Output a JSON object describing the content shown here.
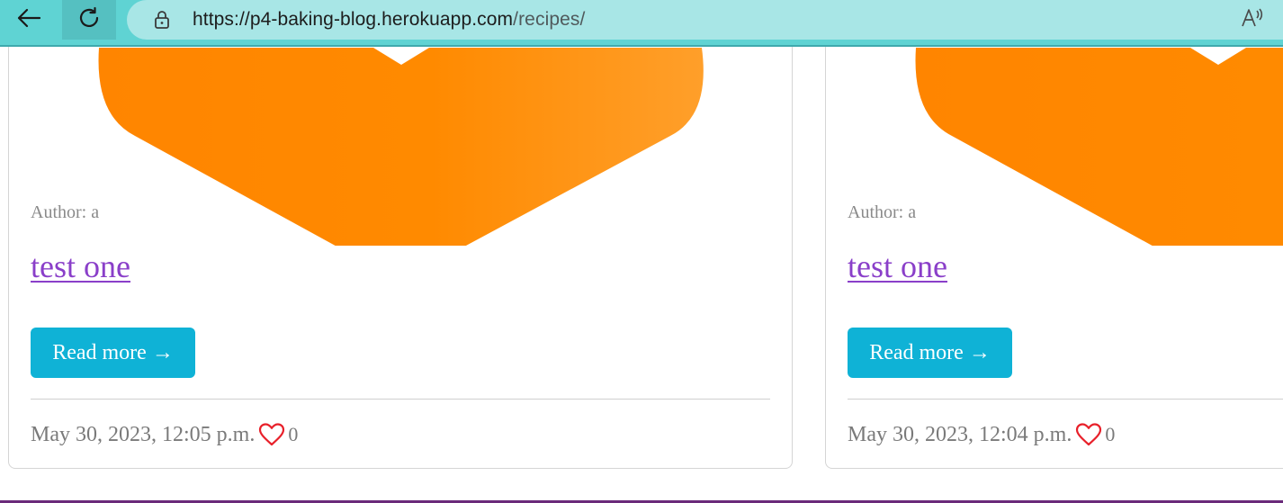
{
  "browser": {
    "url_host": "https://p4-baking-blog.herokuapp.com",
    "url_path": "/recipes/",
    "icons": {
      "back": "back-arrow-icon",
      "reload": "reload-icon",
      "lock": "lock-icon",
      "read_aloud": "read-aloud-icon"
    },
    "colors": {
      "toolbar": "#5fd3d3",
      "address_bar": "#a8e6e6"
    }
  },
  "posts": [
    {
      "author": "Author: a",
      "title": "test one",
      "read_more_label": "Read more →",
      "date": "May 30, 2023, 12:05 p.m.",
      "likes": "0"
    },
    {
      "author": "Author: a",
      "title": "test one",
      "read_more_label": "Read more →",
      "date": "May 30, 2023, 12:04 p.m.",
      "likes": "0"
    }
  ],
  "colors": {
    "link": "#8a3fc9",
    "button": "#0fb2d6",
    "heart": "#e8202a",
    "image_orange": "#ff8c00",
    "footer_rule": "#6a2a7a"
  }
}
